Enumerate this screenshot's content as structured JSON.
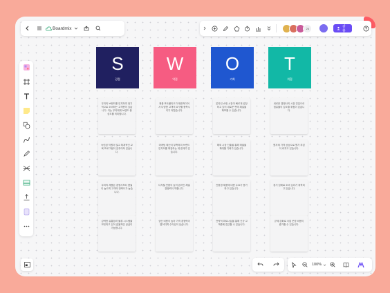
{
  "app": {
    "title": "Boardmix"
  },
  "topbar": {
    "left_icons": [
      "back-icon",
      "menu-icon",
      "cloud-logo-icon",
      "chevron-down-icon",
      "upload-icon",
      "search-icon"
    ],
    "right_icons": [
      "chevron-right-icon",
      "add-icon",
      "pen-icon",
      "shapes-icon",
      "timer-icon",
      "vote-icon",
      "more-icon"
    ],
    "avatar_count": "24",
    "share_label": "공유",
    "help_icon": "help-icon"
  },
  "swot": [
    {
      "letter": "S",
      "label": "강점",
      "color": "#202060",
      "notes": [
        "우리의 브랜드를 인지하여 정기적으로 소비하는 고객층이 있습니다. 이는 우리에게 브랜드 충성도를 의미합니다.",
        "숙련된 직원이 많고 체계적인 교육 프로그램이 갖추어져 있습니다.",
        "우리의 제품은 경쟁사보다 품질이 높으며 고객의 만족도가 높습니다.",
        "강력한 유통망과 물류 시스템을 보유하고 있어 효율적인 공급이 가능합니다."
      ]
    },
    {
      "letter": "W",
      "label": "약점",
      "color": "#f65c82",
      "notes": [
        "제품 포트폴리오가 제한적이어서 다양한 고객의 요구를 충족시키기 어렵습니다.",
        "마케팅 예산이 부족하여 브랜드 인지도를 확장하는 데 한계가 있습니다.",
        "디지털 전환이 늦어 온라인 채널 경쟁력이 약합니다.",
        "생산 비용이 높아 가격 경쟁력이 떨어지며 수익성이 낮습니다."
      ]
    },
    {
      "letter": "O",
      "label": "기회",
      "color": "#1f57d0",
      "notes": [
        "온라인 쇼핑 시장이 빠르게 성장하고 있어 새로운 판매 채널을 확보할 수 있습니다.",
        "해외 시장 진출을 통해 매출을 확대할 기회가 있습니다.",
        "친환경 제품에 대한 수요가 증가하고 있습니다.",
        "전략적 파트너십을 통해 신규 고객층에 접근할 수 있습니다."
      ]
    },
    {
      "letter": "T",
      "label": "위협",
      "color": "#12b8a6",
      "notes": [
        "새로운 경쟁사의 시장 진입으로 점유율이 감소할 위험이 있습니다.",
        "원자재 가격 상승으로 원가 부담이 커지고 있습니다.",
        "경기 침체로 소비 심리가 위축되고 있습니다.",
        "규제 강화로 사업 운영 비용이 증가할 수 있습니다."
      ]
    }
  ],
  "left_toolbar": [
    "templates-icon",
    "frame-icon",
    "text-icon",
    "sticky-note-icon",
    "shapes-icon",
    "connector-icon",
    "pen-icon",
    "mindmap-icon",
    "table-icon",
    "upload-icon",
    "document-icon",
    "more-icon"
  ],
  "bottom": {
    "zoom": "100%",
    "undo_icon": "undo-icon",
    "redo_icon": "redo-icon"
  },
  "colors": {
    "accent": "#6a4cf5",
    "brand_corner": "#fd5b63"
  }
}
